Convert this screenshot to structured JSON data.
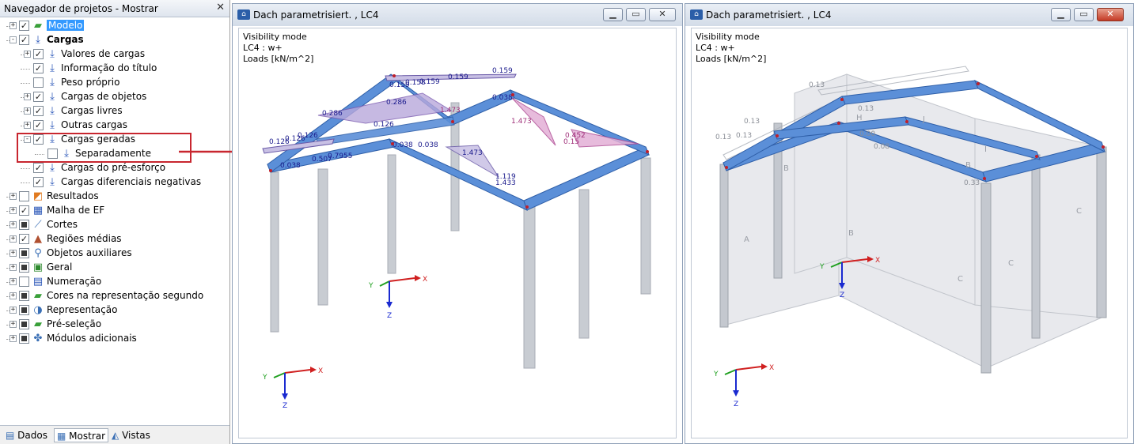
{
  "navigator": {
    "title": "Navegador de projetos - Mostrar",
    "close": "✕",
    "tree": [
      {
        "label": "Modelo",
        "selected": true
      },
      {
        "label": "Cargas",
        "bold": true
      },
      {
        "label": "Valores de cargas"
      },
      {
        "label": "Informação do título"
      },
      {
        "label": "Peso próprio"
      },
      {
        "label": "Cargas de objetos"
      },
      {
        "label": "Cargas livres"
      },
      {
        "label": "Outras cargas"
      },
      {
        "label": "Cargas geradas"
      },
      {
        "label": "Separadamente"
      },
      {
        "label": "Cargas do pré-esforço"
      },
      {
        "label": "Cargas diferenciais negativas"
      },
      {
        "label": "Resultados"
      },
      {
        "label": "Malha de EF"
      },
      {
        "label": "Cortes"
      },
      {
        "label": "Regiões médias"
      },
      {
        "label": "Objetos auxiliares"
      },
      {
        "label": "Geral"
      },
      {
        "label": "Numeração"
      },
      {
        "label": "Cores na representação segundo"
      },
      {
        "label": "Representação"
      },
      {
        "label": "Pré-seleção"
      },
      {
        "label": "Módulos adicionais"
      }
    ],
    "tabs": [
      "Dados",
      "Mostrar",
      "Vistas"
    ]
  },
  "windows": [
    {
      "title": "Dach parametrisiert. , LC4",
      "info": [
        "Visibility mode",
        "LC4 : w+",
        "Loads [kN/m^2]"
      ],
      "load_labels": [
        "0.159",
        "0.158",
        "0.159",
        "0.159",
        "0.159",
        "0.286",
        "0.286",
        "0.126",
        "0.126",
        "0.126",
        "0.126",
        "1.473",
        "1.473",
        "1.473",
        "0.038",
        "0.038",
        "0.038",
        "0.507",
        "0.7955",
        "1.119",
        "1.433",
        "0.452",
        "0.15",
        "0.038"
      ],
      "axes": [
        "X",
        "Y",
        "Z"
      ]
    },
    {
      "title": "Dach parametrisiert. , LC4",
      "info": [
        "Visibility mode",
        "LC4 : w+",
        "Loads [kN/m^2]"
      ],
      "load_labels": [
        "0.13",
        "0.13",
        "0.13",
        "0.13",
        "0.13",
        "0.33",
        "0.00",
        "0.08"
      ],
      "surface_labels": [
        "A",
        "B",
        "C",
        "B",
        "C",
        "H",
        "I",
        "J",
        "B",
        "C"
      ],
      "axes": [
        "X",
        "Y",
        "Z"
      ]
    }
  ],
  "colors": {
    "beam": "#5b8fd8",
    "load": "#9b74c8",
    "load_hot": "#c050a0",
    "selection": "#3399ff",
    "highlight": "#c8262f"
  }
}
